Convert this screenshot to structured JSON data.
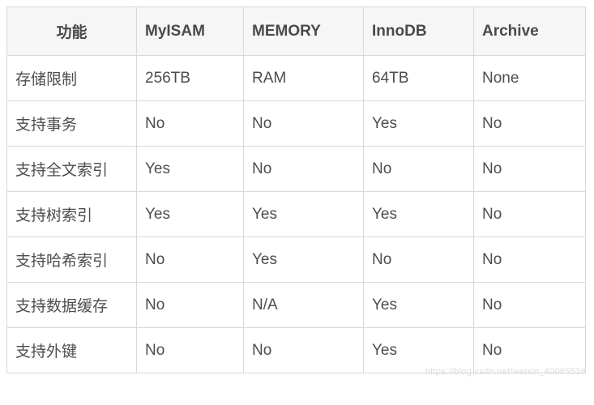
{
  "chart_data": {
    "type": "table",
    "headers": [
      "功能",
      "MyISAM",
      "MEMORY",
      "InnoDB",
      "Archive"
    ],
    "rows": [
      [
        "存储限制",
        "256TB",
        "RAM",
        "64TB",
        "None"
      ],
      [
        "支持事务",
        "No",
        "No",
        "Yes",
        "No"
      ],
      [
        "支持全文索引",
        "Yes",
        "No",
        "No",
        "No"
      ],
      [
        "支持树索引",
        "Yes",
        "Yes",
        "Yes",
        "No"
      ],
      [
        "支持哈希索引",
        "No",
        "Yes",
        "No",
        "No"
      ],
      [
        "支持数据缓存",
        "No",
        "N/A",
        "Yes",
        "No"
      ],
      [
        "支持外键",
        "No",
        "No",
        "Yes",
        "No"
      ]
    ]
  },
  "watermark": "https://blog.csdn.net/weixin_40065538"
}
